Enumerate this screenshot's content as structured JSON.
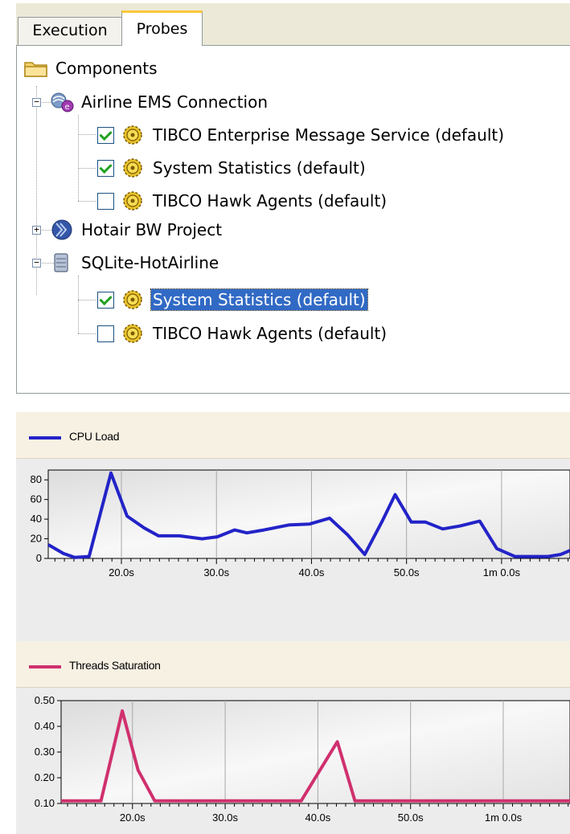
{
  "tabs": [
    {
      "label": "Execution",
      "active": false
    },
    {
      "label": "Probes",
      "active": true
    }
  ],
  "tree": {
    "root": {
      "label": "Components",
      "icon": "folder-icon"
    },
    "nodes": [
      {
        "label": "Airline EMS Connection",
        "icon": "ems-connection-icon",
        "expanded": true,
        "children": [
          {
            "label": "TIBCO Enterprise Message Service (default)",
            "checked": true,
            "icon": "gear-icon"
          },
          {
            "label": "System Statistics (default)",
            "checked": true,
            "icon": "gear-icon"
          },
          {
            "label": "TIBCO Hawk Agents (default)",
            "checked": false,
            "icon": "gear-icon"
          }
        ]
      },
      {
        "label": "Hotair BW Project",
        "icon": "bw-project-icon",
        "expanded": false,
        "children": []
      },
      {
        "label": "SQLite-HotAirline",
        "icon": "database-icon",
        "expanded": true,
        "children": [
          {
            "label": "System Statistics (default)",
            "checked": true,
            "icon": "gear-icon",
            "selected": true
          },
          {
            "label": "TIBCO Hawk Agents (default)",
            "checked": false,
            "icon": "gear-icon"
          }
        ]
      }
    ]
  },
  "chart_data": [
    {
      "type": "line",
      "legend": "CPU Load",
      "color": "#2323c8",
      "x_ticks": [
        "20.0s",
        "30.0s",
        "40.0s",
        "50.0s",
        "1m 0.0s"
      ],
      "x_tick_values": [
        20,
        30,
        40,
        50,
        60
      ],
      "xlim": [
        12.3,
        67.2
      ],
      "y_ticks": [
        "0",
        "20",
        "40",
        "60",
        "80"
      ],
      "y_tick_values": [
        0,
        20,
        40,
        60,
        80
      ],
      "ylim": [
        0,
        90
      ],
      "series": [
        {
          "x": [
            12.3,
            13.9,
            15.1,
            16.6,
            18.9,
            20.6,
            22.4,
            23.9,
            26.1,
            28.5,
            30.1,
            31.9,
            33.2,
            35.0,
            37.6,
            39.8,
            41.9,
            43.8,
            45.6,
            47.5,
            48.8,
            50.5,
            52.0,
            53.8,
            55.6,
            57.7,
            59.5,
            61.4,
            63.2,
            64.9,
            66.2,
            67.2
          ],
          "y": [
            14,
            5,
            1,
            2,
            87,
            43,
            31,
            23,
            23,
            20,
            22,
            29,
            26,
            29,
            34,
            35,
            41,
            24,
            4,
            39,
            65,
            37,
            37,
            30,
            33,
            38,
            10,
            2,
            2,
            2,
            4,
            8
          ]
        }
      ]
    },
    {
      "type": "line",
      "legend": "Threads Saturation",
      "color": "#d0306e",
      "x_ticks": [
        "20.0s",
        "30.0s",
        "40.0s",
        "50.0s",
        "1m 0.0s"
      ],
      "x_tick_values": [
        20,
        30,
        40,
        50,
        60
      ],
      "xlim": [
        12.3,
        67.2
      ],
      "y_ticks": [
        "0.10",
        "0.20",
        "0.30",
        "0.40",
        "0.50"
      ],
      "y_tick_values": [
        0.1,
        0.2,
        0.3,
        0.4,
        0.5
      ],
      "ylim": [
        0.1,
        0.5
      ],
      "series": [
        {
          "x": [
            12.3,
            16.6,
            18.9,
            20.6,
            22.4,
            38.2,
            42.1,
            44.0,
            67.2
          ],
          "y": [
            0.11,
            0.11,
            0.46,
            0.23,
            0.11,
            0.11,
            0.34,
            0.11,
            0.11
          ]
        }
      ]
    }
  ]
}
